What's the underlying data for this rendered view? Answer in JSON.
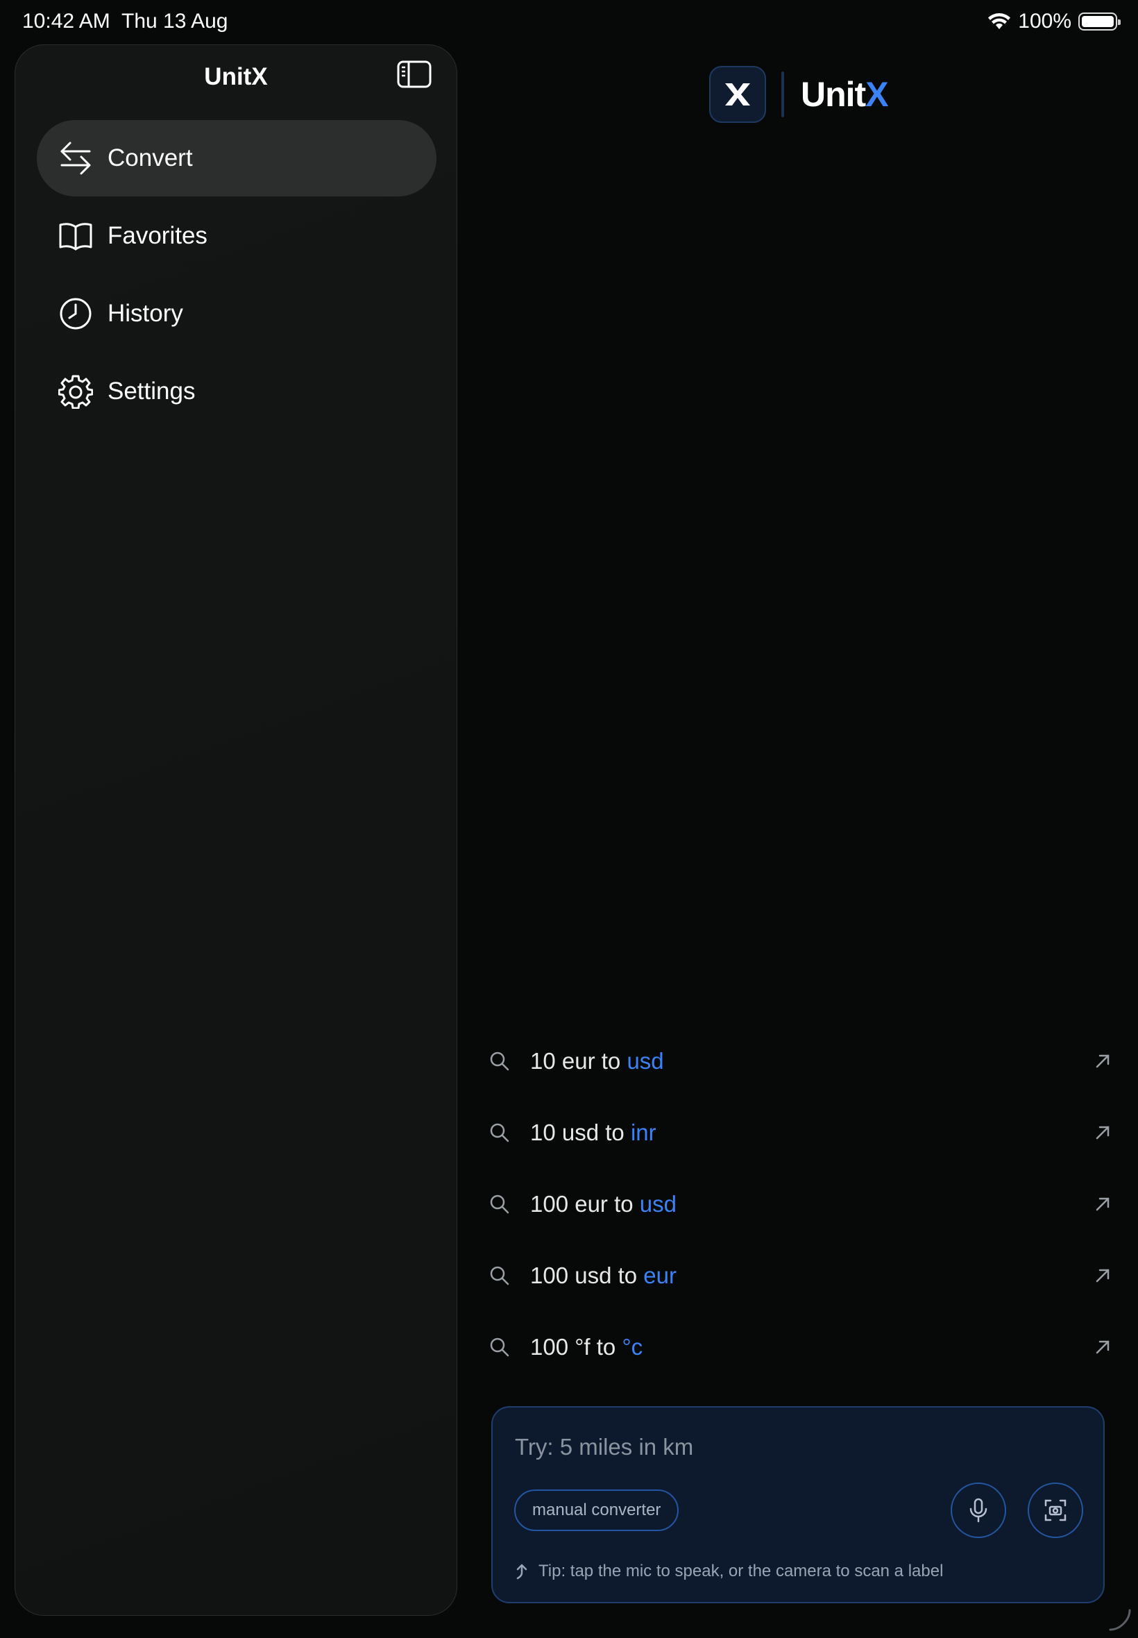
{
  "status_bar": {
    "time": "10:42 AM",
    "date": "Thu 13 Aug",
    "battery": "100%",
    "battery_level": 1.0
  },
  "sidebar": {
    "title": "UnitX",
    "items": [
      {
        "label": "Convert",
        "icon": "arrows-swap-icon",
        "active": true
      },
      {
        "label": "Favorites",
        "icon": "book-icon",
        "active": false
      },
      {
        "label": "History",
        "icon": "clock-icon",
        "active": false
      },
      {
        "label": "Settings",
        "icon": "gear-icon",
        "active": false
      }
    ]
  },
  "header": {
    "logo_text": "Unit",
    "logo_accent": "X"
  },
  "suggestions": [
    {
      "prefix": "10 eur to ",
      "target": "usd"
    },
    {
      "prefix": "10 usd to ",
      "target": "inr"
    },
    {
      "prefix": "100 eur to ",
      "target": "usd"
    },
    {
      "prefix": "100 usd to ",
      "target": "eur"
    },
    {
      "prefix": "100 °f to ",
      "target": "°c"
    }
  ],
  "input": {
    "placeholder": "Try: 5 miles in km",
    "chip_label": "manual converter",
    "tip": "Tip: tap the mic to speak, or the camera to scan a label"
  },
  "colors": {
    "background": "#070908",
    "sidebar": "#131515",
    "accent": "#3b82f6",
    "input_card": "#0d1a2e"
  }
}
